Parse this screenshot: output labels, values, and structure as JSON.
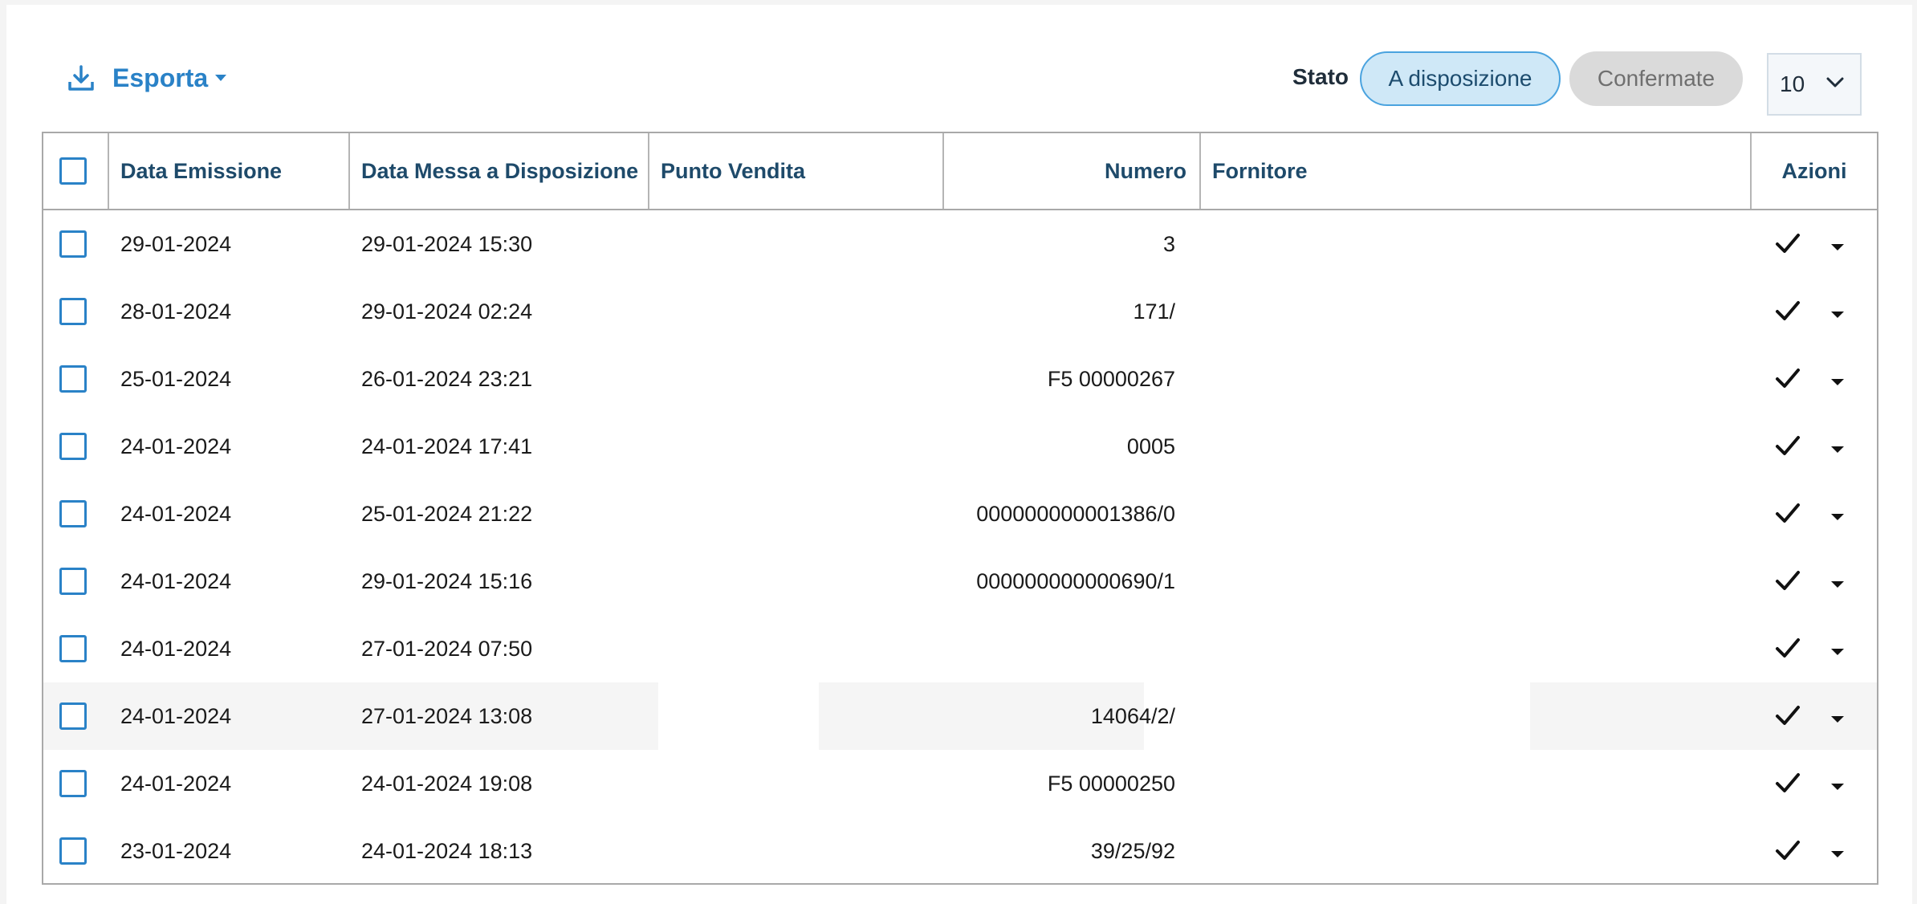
{
  "toolbar": {
    "export_label": "Esporta",
    "export_icon": "download-icon",
    "status_label": "Stato",
    "status_filters": [
      {
        "label": "A disposizione",
        "active": true
      },
      {
        "label": "Confermate",
        "active": false
      }
    ],
    "page_size": "10"
  },
  "table": {
    "columns": [
      "Data Emissione",
      "Data Messa a Disposizione",
      "Punto Vendita",
      "Numero",
      "Fornitore",
      "Azioni"
    ],
    "rows": [
      {
        "data_emissione": "29-01-2024",
        "data_messa": "29-01-2024 15:30",
        "punto_vendita": "",
        "numero": "3",
        "fornitore": ""
      },
      {
        "data_emissione": "28-01-2024",
        "data_messa": "29-01-2024 02:24",
        "punto_vendita": "",
        "numero": "171/",
        "fornitore": ""
      },
      {
        "data_emissione": "25-01-2024",
        "data_messa": "26-01-2024 23:21",
        "punto_vendita": "",
        "numero": "F5 00000267",
        "fornitore": ""
      },
      {
        "data_emissione": "24-01-2024",
        "data_messa": "24-01-2024 17:41",
        "punto_vendita": "",
        "numero": "0005",
        "fornitore": ""
      },
      {
        "data_emissione": "24-01-2024",
        "data_messa": "25-01-2024 21:22",
        "punto_vendita": "",
        "numero": "000000000001386/0",
        "fornitore": ""
      },
      {
        "data_emissione": "24-01-2024",
        "data_messa": "29-01-2024 15:16",
        "punto_vendita": "",
        "numero": "000000000000690/1",
        "fornitore": ""
      },
      {
        "data_emissione": "24-01-2024",
        "data_messa": "27-01-2024 07:50",
        "punto_vendita": "",
        "numero": "",
        "fornitore": ""
      },
      {
        "data_emissione": "24-01-2024",
        "data_messa": "27-01-2024 13:08",
        "punto_vendita": "",
        "numero": "14064/2/",
        "fornitore": "",
        "highlighted": true
      },
      {
        "data_emissione": "24-01-2024",
        "data_messa": "24-01-2024 19:08",
        "punto_vendita": "",
        "numero": "F5 00000250",
        "fornitore": ""
      },
      {
        "data_emissione": "23-01-2024",
        "data_messa": "24-01-2024 18:13",
        "punto_vendita": "",
        "numero": "39/25/92",
        "fornitore": ""
      }
    ],
    "row_actions": {
      "confirm_icon": "check-icon",
      "menu_icon": "caret-down-icon"
    }
  },
  "colors": {
    "accent": "#2a82c7",
    "header_text": "#1e4a6a",
    "pill_active_bg": "#cfe8f7",
    "pill_inactive_bg": "#dadada"
  }
}
